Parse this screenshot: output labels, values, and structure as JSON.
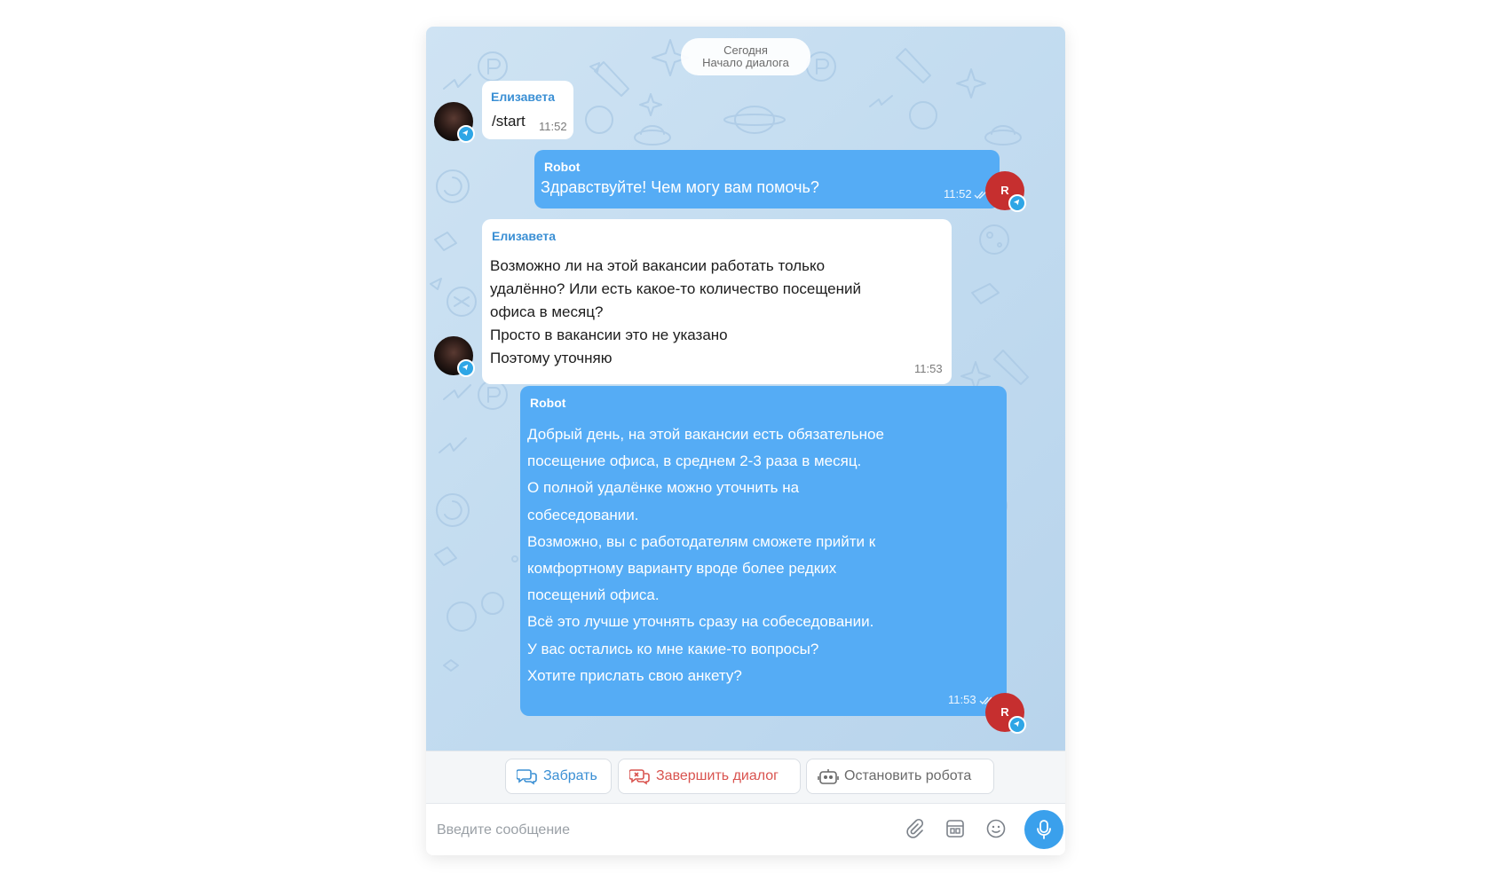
{
  "date_divider": {
    "day": "Сегодня",
    "caption": "Начало диалога"
  },
  "messages": [
    {
      "sender": "Елизавета",
      "text": "/start",
      "time": "11:52",
      "direction": "incoming"
    },
    {
      "sender": "Robot",
      "text": "Здравствуйте! Чем могу вам помочь?",
      "time": "11:52",
      "direction": "outgoing",
      "read": true
    },
    {
      "sender": "Елизавета",
      "text": "Возможно ли на этой вакансии работать только\nудалённо? Или есть какое-то количество посещений\nофиса в месяц?\nПросто в вакансии это не указано\nПоэтому уточняю",
      "time": "11:53",
      "direction": "incoming"
    },
    {
      "sender": "Robot",
      "text": "Добрый день, на этой вакансии есть обязательное\nпосещение офиса, в среднем 2-3 раза в месяц.\nО полной удалёнке можно уточнить на\nсобеседовании.\nВозможно, вы с работодателям сможете прийти к\nкомфортному варианту вроде более редких\nпосещений офиса.\nВсё это лучше уточнять сразу на собеседовании.\nУ вас остались ко мне какие-то вопросы?\nХотите прислать свою анкету?",
      "time": "11:53",
      "direction": "outgoing",
      "read": true
    }
  ],
  "robot_avatar_letter": "R",
  "actions": {
    "take": "Забрать",
    "end_dialog": "Завершить диалог",
    "stop_robot": "Остановить робота"
  },
  "composer": {
    "placeholder": "Введите сообщение",
    "value": ""
  },
  "icons": {
    "attach": "paperclip-icon",
    "templates": "template-icon",
    "emoji": "emoji-icon",
    "voice": "microphone-icon",
    "take": "chat-bubbles-icon",
    "end": "chat-close-icon",
    "stop": "robot-icon"
  },
  "colors": {
    "outgoing_bubble": "#55acf5",
    "incoming_bubble": "#ffffff",
    "sender_incoming": "#3a8fd4",
    "robot_avatar": "#c62f2f",
    "end_dialog": "#d9534f",
    "mic_button": "#3aa0ec"
  }
}
